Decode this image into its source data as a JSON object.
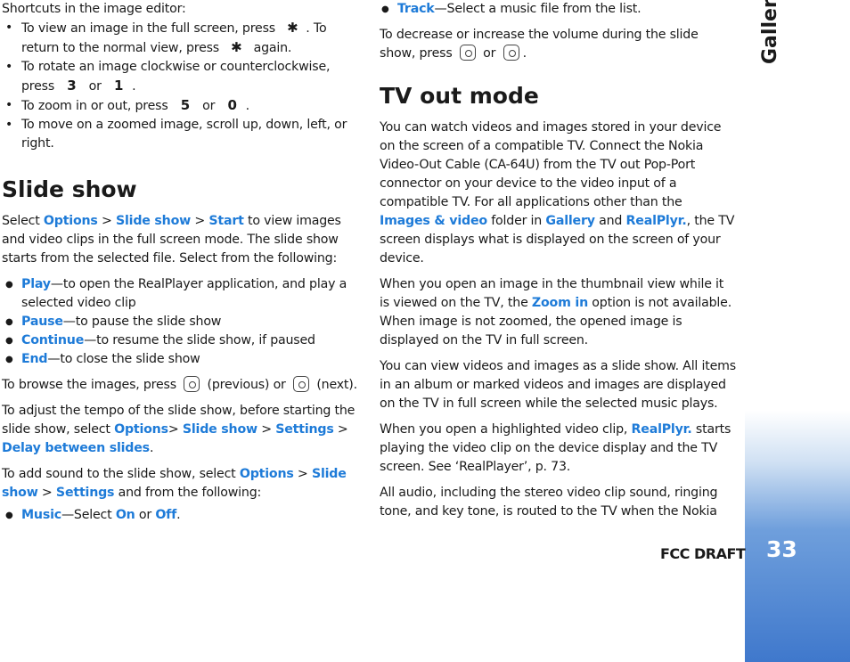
{
  "sidebar": {
    "section_title": "Gallery",
    "page_number": "33",
    "accent_color": "#3f78cc"
  },
  "footer": {
    "draft_label": "FCC DRAFT"
  },
  "left": {
    "shortcuts_intro": "Shortcuts in the image editor:",
    "shortcuts": {
      "s1_a": "To view an image in the full screen, press ",
      "s1_key1": "✱",
      "s1_b": ". To return to the normal view, press ",
      "s1_key2": "✱",
      "s1_c": " again.",
      "s2_a": "To rotate an image clockwise or counterclockwise, press ",
      "s2_key1": "3",
      "s2_b": " or ",
      "s2_key2": "1",
      "s2_c": ".",
      "s3_a": "To zoom in or out, press ",
      "s3_key1": "5",
      "s3_b": " or ",
      "s3_key2": "0",
      "s3_c": ".",
      "s4": "To move on a zoomed image, scroll up, down, left, or right."
    },
    "slideshow_heading": "Slide show",
    "p1": {
      "a": "Select ",
      "options": "Options",
      "sep1": " > ",
      "slideshow": "Slide show",
      "sep2": " > ",
      "start": "Start",
      "b": " to view images and video clips in the full screen mode. The slide show starts from the selected file. Select from the following:"
    },
    "items": [
      {
        "term": "Play",
        "desc": "—to open the RealPlayer application, and play a selected video clip"
      },
      {
        "term": "Pause",
        "desc": "—to pause the slide show"
      },
      {
        "term": "Continue",
        "desc": "—to resume the slide show, if paused"
      },
      {
        "term": "End",
        "desc": "—to close the slide show"
      }
    ],
    "p2": {
      "a": "To browse the images, press ",
      "b": " (previous) or ",
      "c": " (next)."
    },
    "p3": {
      "a": "To adjust the tempo of the slide show, before starting the slide show, select ",
      "options": "Options",
      "sep1": "> ",
      "slideshow": "Slide show",
      "sep2": " > ",
      "settings": "Settings",
      "sep3": " > ",
      "delay": "Delay between slides",
      "end": "."
    },
    "p4": {
      "a": "To add sound to the slide show, select ",
      "options": "Options",
      "sep1": " > ",
      "slideshow": "Slide show",
      "sep2": " > ",
      "settings": "Settings",
      "b": " and from the following:"
    },
    "music": {
      "term": "Music",
      "a": "—Select ",
      "on": "On",
      "or": " or ",
      "off": "Off",
      "end": "."
    }
  },
  "right": {
    "track": {
      "term": "Track",
      "desc": "—Select a music file from the list."
    },
    "volume": {
      "a": "To decrease or increase the volume during the slide show, press ",
      "or": " or ",
      "end": "."
    },
    "tv_heading": "TV out mode",
    "tv_p1": {
      "a": "You can watch videos and images stored in your device on the screen of a compatible TV. Connect the Nokia Video-Out Cable (CA-64U) from the TV out Pop-Port connector on your device to the video input of a compatible TV. For all applications other than the ",
      "images_video": "Images & video",
      "b": " folder in ",
      "gallery": "Gallery",
      "and": " and ",
      "realplyr": "RealPlyr.",
      "c": ", the TV screen displays what is displayed on the screen of your device."
    },
    "tv_p2": {
      "a": "When you open an image in the thumbnail view while it is viewed on the TV, the ",
      "zoom_in": "Zoom in",
      "b": " option is not available. When image is not zoomed, the opened image is displayed on the TV in full screen."
    },
    "tv_p3": "You can view videos and images as a slide show. All items in an album or marked videos and images are displayed on the TV in full screen while the selected music plays.",
    "tv_p4": {
      "a": "When you open a highlighted video clip, ",
      "realplyr": "RealPlyr.",
      "b": " starts playing the video clip on the device display and the TV screen. See ‘RealPlayer’, p. 73."
    },
    "tv_p5": "All audio, including the stereo video clip sound, ringing tone, and key tone, is routed to the TV when the Nokia"
  }
}
